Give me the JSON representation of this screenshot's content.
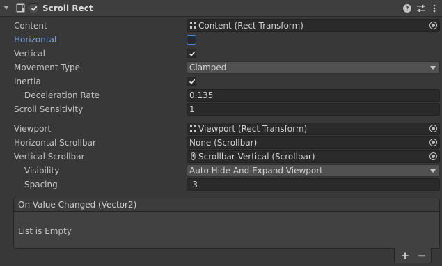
{
  "component": {
    "title": "Scroll Rect",
    "enabled": true
  },
  "fields": {
    "content": {
      "label": "Content",
      "value": "Content (Rect Transform)",
      "icon": "rect-transform-icon"
    },
    "horizontal": {
      "label": "Horizontal",
      "checked": false
    },
    "vertical": {
      "label": "Vertical",
      "checked": true
    },
    "movement_type": {
      "label": "Movement Type",
      "value": "Clamped"
    },
    "inertia": {
      "label": "Inertia",
      "checked": true
    },
    "deceleration_rate": {
      "label": "Deceleration Rate",
      "value": "0.135"
    },
    "scroll_sensitivity": {
      "label": "Scroll Sensitivity",
      "value": "1"
    },
    "viewport": {
      "label": "Viewport",
      "value": "Viewport (Rect Transform)",
      "icon": "rect-transform-icon"
    },
    "horizontal_scrollbar": {
      "label": "Horizontal Scrollbar",
      "value": "None (Scrollbar)"
    },
    "vertical_scrollbar": {
      "label": "Vertical Scrollbar",
      "value": "Scrollbar Vertical (Scrollbar)",
      "icon": "scrollbar-icon"
    },
    "visibility": {
      "label": "Visibility",
      "value": "Auto Hide And Expand Viewport"
    },
    "spacing": {
      "label": "Spacing",
      "value": "-3"
    }
  },
  "event": {
    "title": "On Value Changed (Vector2)",
    "empty_text": "List is Empty",
    "add_label": "+",
    "remove_label": "−"
  },
  "colors": {
    "background": "#383838",
    "field": "#2a2a2a",
    "highlight_label": "#7ba4e0"
  }
}
